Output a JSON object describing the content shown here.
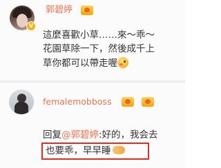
{
  "posts": [
    {
      "username": "郭碧婷",
      "verified_badge": "V",
      "lines": [
        "這麼喜歡小草……來～乖～",
        "花園草除一下，然後成千上",
        "草你都可以帶走喔"
      ]
    },
    {
      "username": "femalemobboss",
      "reply_prefix": "回复",
      "reply_mention": "@郭碧婷",
      "reply_rest": ":好的，我会去",
      "highlight_text": "也要乖，早早睡"
    }
  ],
  "icons": {
    "member": "weibo-member-icon",
    "emoji_smile": "blush-emoji-icon",
    "emoji_handshake": "handshake-emoji-icon",
    "badge": "verified-v-icon"
  },
  "colors": {
    "username": "#eb7350",
    "text": "#333333",
    "highlight_border": "#e32b22",
    "badge": "#f6b11a"
  }
}
